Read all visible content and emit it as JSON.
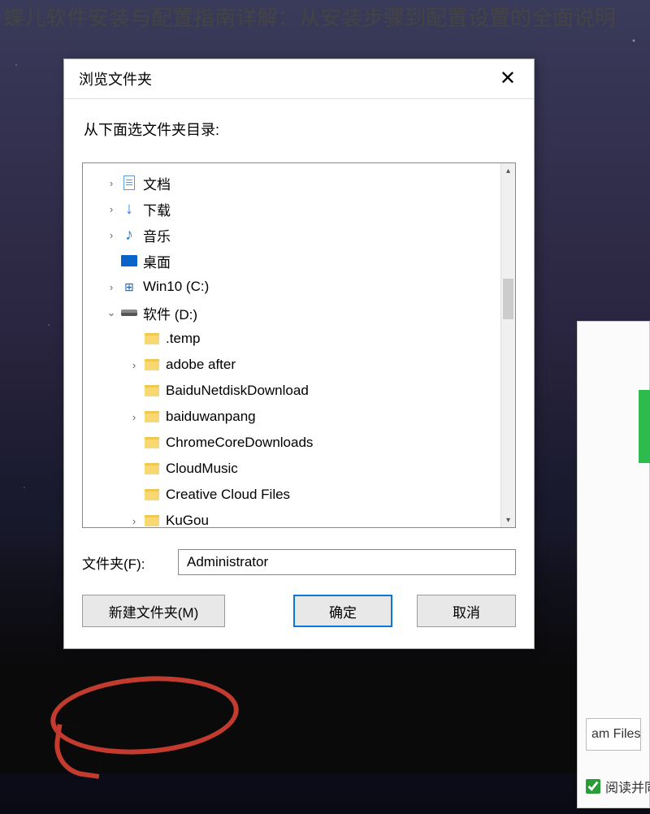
{
  "page_title": "蝶儿软件安装与配置指南详解：从安装步骤到配置设置的全面说明",
  "dialog": {
    "title": "浏览文件夹",
    "close_glyph": "✕",
    "instruction": "从下面选文件夹目录:",
    "folder_label": "文件夹(F):",
    "folder_value": "Administrator",
    "btn_new": "新建文件夹(M)",
    "btn_ok": "确定",
    "btn_cancel": "取消"
  },
  "tree": {
    "items": [
      {
        "label": "文档",
        "icon": "doc",
        "chev": ">",
        "indent": 1
      },
      {
        "label": "下载",
        "icon": "download",
        "chev": ">",
        "indent": 1
      },
      {
        "label": "音乐",
        "icon": "music",
        "chev": ">",
        "indent": 1
      },
      {
        "label": "桌面",
        "icon": "desktop",
        "chev": "",
        "indent": 1
      },
      {
        "label": "Win10 (C:)",
        "icon": "win",
        "chev": ">",
        "indent": 1
      },
      {
        "label": "软件 (D:)",
        "icon": "drive",
        "chev": "v",
        "indent": 1
      },
      {
        "label": ".temp",
        "icon": "folder",
        "chev": "",
        "indent": 2
      },
      {
        "label": "adobe after",
        "icon": "folder",
        "chev": ">",
        "indent": 2
      },
      {
        "label": "BaiduNetdiskDownload",
        "icon": "folder",
        "chev": "",
        "indent": 2
      },
      {
        "label": "baiduwanpang",
        "icon": "folder",
        "chev": ">",
        "indent": 2
      },
      {
        "label": "ChromeCoreDownloads",
        "icon": "folder",
        "chev": "",
        "indent": 2
      },
      {
        "label": "CloudMusic",
        "icon": "folder",
        "chev": "",
        "indent": 2
      },
      {
        "label": "Creative Cloud Files",
        "icon": "folder",
        "chev": "",
        "indent": 2
      },
      {
        "label": "KuGou",
        "icon": "folder",
        "chev": ">",
        "indent": 2
      }
    ]
  },
  "side": {
    "strip_text": "am Files",
    "check_label": "阅读并同"
  }
}
